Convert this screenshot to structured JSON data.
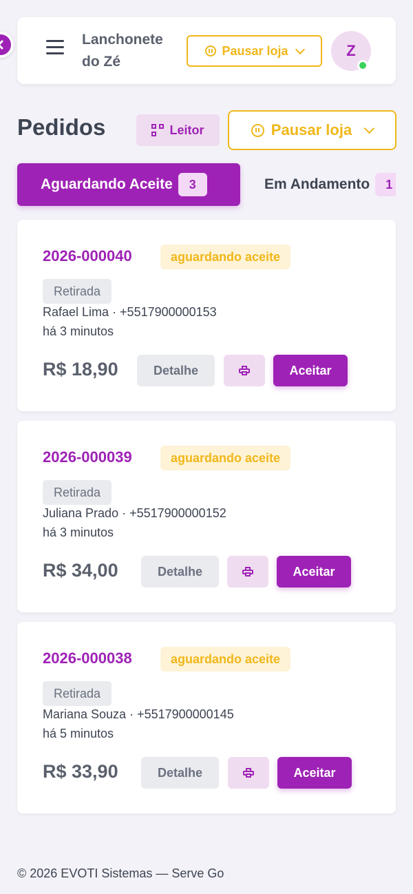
{
  "header": {
    "store_name": "Lanchonete do Zé",
    "pause_label": "Pausar loja",
    "avatar_initial": "Z"
  },
  "page": {
    "title": "Pedidos",
    "reader_label": "Leitor",
    "pause_label": "Pausar loja"
  },
  "tabs": [
    {
      "label": "Aguardando Aceite",
      "count": "3",
      "active": true
    },
    {
      "label": "Em Andamento",
      "count": "1",
      "active": false
    }
  ],
  "orders": [
    {
      "id": "2026-000040",
      "status": "aguardando aceite",
      "type": "Retirada",
      "customer": "Rafael Lima · +5517900000153",
      "time": "há 3 minutos",
      "price": "R$ 18,90",
      "detail_label": "Detalhe",
      "accept_label": "Aceitar"
    },
    {
      "id": "2026-000039",
      "status": "aguardando aceite",
      "type": "Retirada",
      "customer": "Juliana Prado · +5517900000152",
      "time": "há 3 minutos",
      "price": "R$ 34,00",
      "detail_label": "Detalhe",
      "accept_label": "Aceitar"
    },
    {
      "id": "2026-000038",
      "status": "aguardando aceite",
      "type": "Retirada",
      "customer": "Mariana Souza · +5517900000145",
      "time": "há 5 minutos",
      "price": "R$ 33,90",
      "detail_label": "Detalhe",
      "accept_label": "Aceitar"
    }
  ],
  "footer": {
    "text": "© 2026 EVOTI Sistemas — Serve Go"
  },
  "colors": {
    "brand": "#9e22b5",
    "warning": "#f0b71a",
    "background": "#f3f2f8",
    "online": "#3ed15c"
  }
}
